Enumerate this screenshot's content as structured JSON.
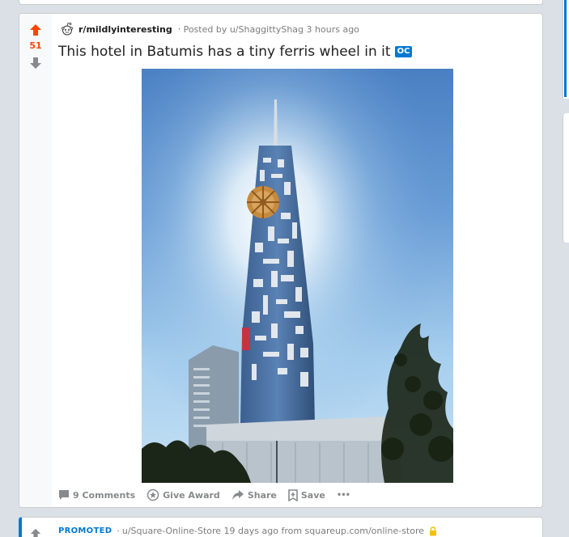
{
  "post": {
    "score": "51",
    "subreddit": "r/mildlyinteresting",
    "separator": "·",
    "posted_by": "Posted by u/ShaggittyShag 3 hours ago",
    "title": "This hotel in Batumis has a tiny ferris wheel in it",
    "flair": "OC"
  },
  "actions": {
    "comments": "9 Comments",
    "award": "Give Award",
    "share": "Share",
    "save": "Save",
    "more": "•••"
  },
  "promoted": {
    "label": "PROMOTED",
    "separator": "·",
    "info": "u/Square-Online-Store 19 days ago from squareup.com/online-store"
  },
  "colors": {
    "upvote": "#ff4500",
    "flair": "#0079d3",
    "promoted": "#0079d3"
  }
}
